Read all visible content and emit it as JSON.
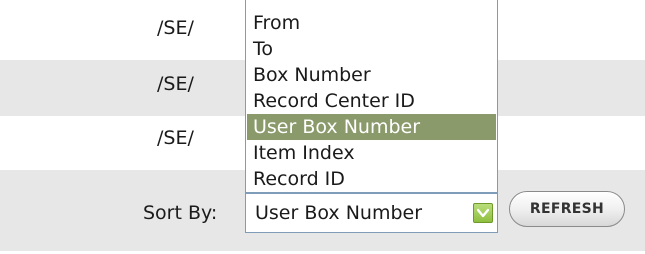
{
  "rows": [
    {
      "path": "/SE/"
    },
    {
      "path": "/SE/"
    },
    {
      "path": "/SE/"
    }
  ],
  "sort": {
    "label": "Sort By:",
    "selected": "User Box Number",
    "options": [
      "From",
      "To",
      "Box Number",
      "Record Center ID",
      "User Box Number",
      "Item Index",
      "Record ID"
    ],
    "highlighted_index": 4
  },
  "refresh_label": "REFRESH",
  "colors": {
    "row_alt": "#e7e7e7",
    "select_border": "#7f9db9",
    "highlight": "#8a9a6b",
    "dropdown_arrow": "#8fbf3f"
  }
}
